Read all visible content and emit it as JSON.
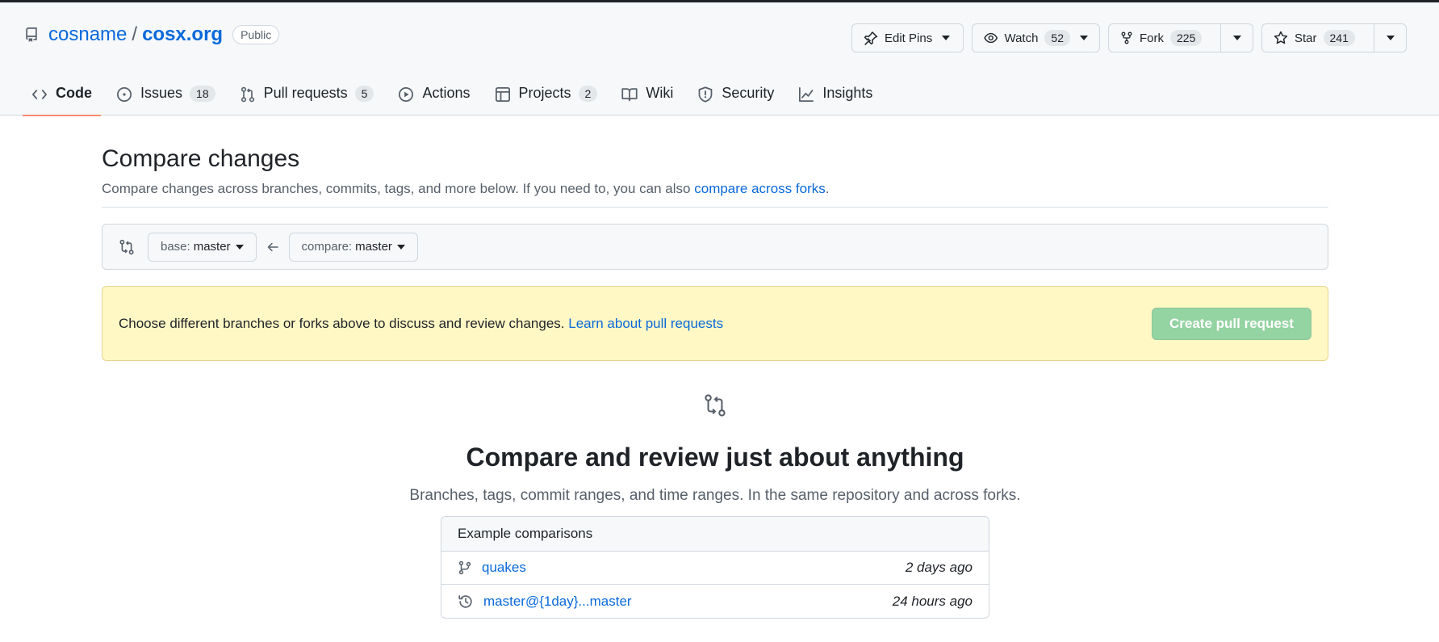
{
  "repo": {
    "owner": "cosname",
    "separator": "/",
    "name": "cosx.org",
    "visibility": "Public"
  },
  "actions": {
    "edit_pins": "Edit Pins",
    "watch": {
      "label": "Watch",
      "count": "52"
    },
    "fork": {
      "label": "Fork",
      "count": "225"
    },
    "star": {
      "label": "Star",
      "count": "241"
    }
  },
  "tabs": [
    {
      "label": "Code",
      "icon": "code-icon",
      "active": true
    },
    {
      "label": "Issues",
      "count": "18",
      "icon": "issue-icon"
    },
    {
      "label": "Pull requests",
      "count": "5",
      "icon": "pull-request-icon"
    },
    {
      "label": "Actions",
      "icon": "play-icon"
    },
    {
      "label": "Projects",
      "count": "2",
      "icon": "table-icon"
    },
    {
      "label": "Wiki",
      "icon": "book-icon"
    },
    {
      "label": "Security",
      "icon": "shield-icon"
    },
    {
      "label": "Insights",
      "icon": "graph-icon"
    }
  ],
  "compare": {
    "title": "Compare changes",
    "desc_prefix": "Compare changes across branches, commits, tags, and more below. If you need to, you can also ",
    "desc_link": "compare across forks",
    "desc_suffix": ".",
    "base_label": "base:",
    "base_value": "master",
    "compare_label": "compare:",
    "compare_value": "master"
  },
  "flash": {
    "text": "Choose different branches or forks above to discuss and review changes. ",
    "link": "Learn about pull requests",
    "button": "Create pull request"
  },
  "blankslate": {
    "title": "Compare and review just about anything",
    "subtitle": "Branches, tags, commit ranges, and time ranges. In the same repository and across forks."
  },
  "examples": {
    "header": "Example comparisons",
    "rows": [
      {
        "label": "quakes",
        "time": "2 days ago",
        "icon": "branch-icon"
      },
      {
        "label": "master@{1day}...master",
        "time": "24 hours ago",
        "icon": "history-icon"
      }
    ]
  },
  "colors": {
    "link": "#0969da",
    "flash_bg": "#fff8c5",
    "create_button": "#94d3a2",
    "active_tab_underline": "#fd8c73"
  }
}
